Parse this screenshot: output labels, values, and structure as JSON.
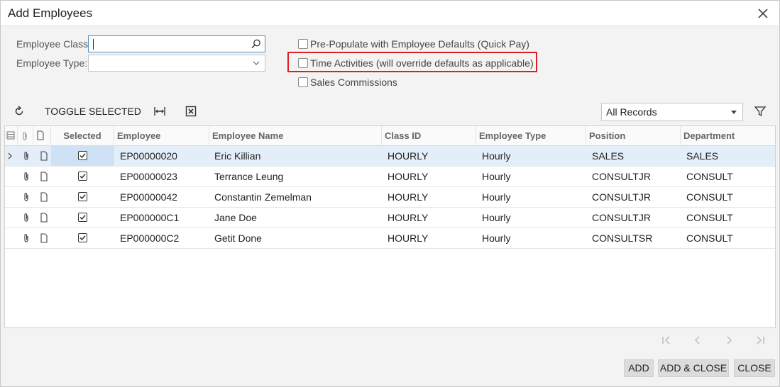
{
  "dialog": {
    "title": "Add Employees"
  },
  "form": {
    "employee_class_label": "Employee Class:",
    "employee_class_value": "",
    "employee_type_label": "Employee Type:",
    "employee_type_value": ""
  },
  "options": {
    "prepopulate_label": "Pre-Populate with Employee Defaults (Quick Pay)",
    "time_activities_label": "Time Activities (will override defaults as applicable)",
    "sales_commissions_label": "Sales Commissions"
  },
  "toolbar": {
    "toggle_selected_label": "TOGGLE SELECTED",
    "filter_value": "All Records"
  },
  "grid": {
    "columns": {
      "selected": "Selected",
      "employee": "Employee",
      "employee_name": "Employee Name",
      "class_id": "Class ID",
      "employee_type": "Employee Type",
      "position": "Position",
      "department": "Department"
    },
    "rows": [
      {
        "employee": "EP00000020",
        "name": "Eric Killian",
        "class_id": "HOURLY",
        "type": "Hourly",
        "position": "SALES",
        "department": "SALES"
      },
      {
        "employee": "EP00000023",
        "name": "Terrance Leung",
        "class_id": "HOURLY",
        "type": "Hourly",
        "position": "CONSULTJR",
        "department": "CONSULT"
      },
      {
        "employee": "EP00000042",
        "name": "Constantin Zemelman",
        "class_id": "HOURLY",
        "type": "Hourly",
        "position": "CONSULTJR",
        "department": "CONSULT"
      },
      {
        "employee": "EP000000C1",
        "name": "Jane Doe",
        "class_id": "HOURLY",
        "type": "Hourly",
        "position": "CONSULTJR",
        "department": "CONSULT"
      },
      {
        "employee": "EP000000C2",
        "name": "Getit Done",
        "class_id": "HOURLY",
        "type": "Hourly",
        "position": "CONSULTSR",
        "department": "CONSULT"
      }
    ]
  },
  "buttons": {
    "add": "ADD",
    "add_close": "ADD & CLOSE",
    "close": "CLOSE"
  },
  "colors": {
    "highlight": "#e02020",
    "active_row": "#e3eef9"
  }
}
